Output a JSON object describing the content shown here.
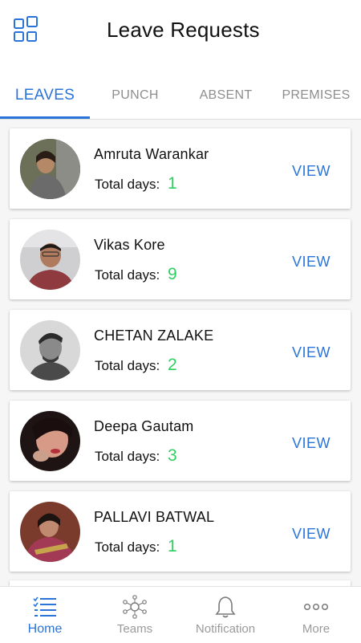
{
  "header": {
    "title": "Leave Requests",
    "menu_icon": "grid-menu-icon"
  },
  "tabs": [
    {
      "label": "LEAVES",
      "active": true
    },
    {
      "label": "PUNCH",
      "active": false
    },
    {
      "label": "ABSENT",
      "active": false
    },
    {
      "label": "PREMISES",
      "active": false
    }
  ],
  "requests": {
    "days_label": "Total days:",
    "view_label": "VIEW",
    "items": [
      {
        "name": "Amruta Warankar",
        "days": "1"
      },
      {
        "name": "Vikas Kore",
        "days": "9"
      },
      {
        "name": "CHETAN ZALAKE",
        "days": "2"
      },
      {
        "name": "Deepa Gautam",
        "days": "3"
      },
      {
        "name": "PALLAVI BATWAL",
        "days": "1"
      }
    ]
  },
  "bottom_nav": [
    {
      "label": "Home",
      "icon": "list-icon",
      "active": true
    },
    {
      "label": "Teams",
      "icon": "team-network-icon",
      "active": false
    },
    {
      "label": "Notification",
      "icon": "bell-icon",
      "active": false
    },
    {
      "label": "More",
      "icon": "more-dots-icon",
      "active": false
    }
  ],
  "colors": {
    "accent": "#2a74d9",
    "days_green": "#2ecf62"
  }
}
